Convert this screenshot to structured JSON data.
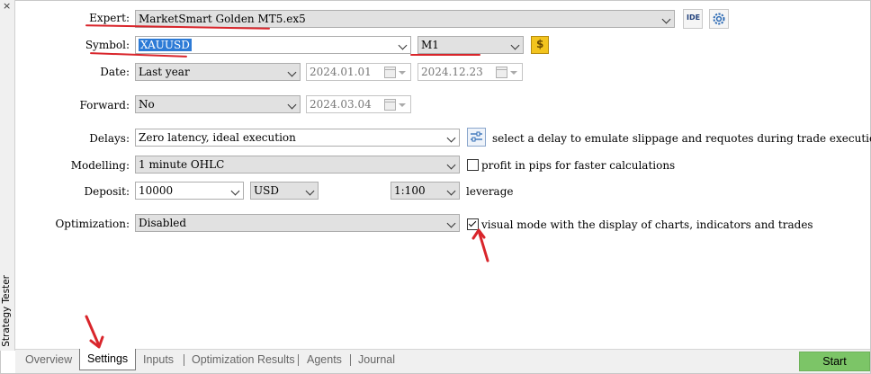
{
  "sidebar": {
    "close_glyph": "×",
    "title": "Strategy Tester"
  },
  "expert": {
    "label": "Expert:",
    "value": "MarketSmart Golden MT5.ex5",
    "ide_label": "IDE",
    "settings_icon": "gear-icon"
  },
  "symbol": {
    "label": "Symbol:",
    "value": "XAUUSD",
    "timeframe": "M1",
    "spec_icon": "dollar-icon"
  },
  "date": {
    "label": "Date:",
    "range": "Last year",
    "from": "2024.01.01",
    "to": "2024.12.23"
  },
  "forward": {
    "label": "Forward:",
    "value": "No",
    "date": "2024.03.04"
  },
  "delays": {
    "label": "Delays:",
    "value": "Zero latency, ideal execution",
    "hint": "select a delay to emulate slippage and requotes during trade execution"
  },
  "modelling": {
    "label": "Modelling:",
    "value": "1 minute OHLC",
    "checkbox_label": "profit in pips for faster calculations",
    "checkbox_checked": false
  },
  "deposit": {
    "label": "Deposit:",
    "amount": "10000",
    "currency": "USD",
    "leverage_value": "1:100",
    "leverage_label": "leverage"
  },
  "optimization": {
    "label": "Optimization:",
    "value": "Disabled",
    "checkbox_label": "visual mode with the display of charts, indicators and trades",
    "checkbox_checked": true
  },
  "tabs": [
    "Overview",
    "Settings",
    "Inputs",
    "Optimization Results",
    "Agents",
    "Journal"
  ],
  "active_tab": "Settings",
  "start_label": "Start",
  "colors": {
    "accent_red": "#d9252b",
    "start_green": "#7cc567",
    "selection_blue": "#2d7bd6"
  }
}
